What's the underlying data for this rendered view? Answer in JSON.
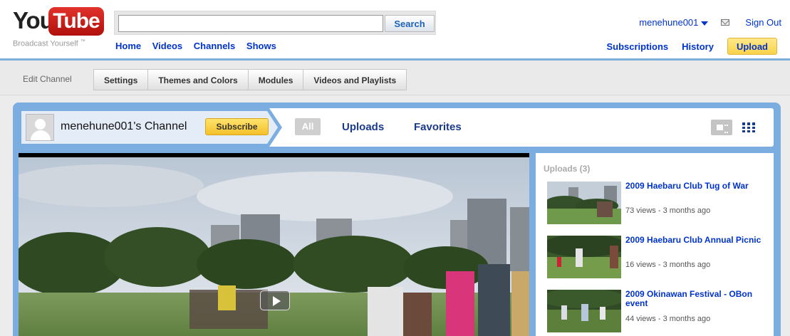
{
  "logo": {
    "you": "You",
    "tube": "Tube",
    "tagline": "Broadcast Yourself",
    "tm": "™"
  },
  "search": {
    "value": "",
    "placeholder": "",
    "button": "Search"
  },
  "main_nav": [
    "Home",
    "Videos",
    "Channels",
    "Shows"
  ],
  "user": {
    "name": "menehune001",
    "sign_out": "Sign Out"
  },
  "sub_nav": {
    "subscriptions": "Subscriptions",
    "history": "History",
    "upload": "Upload"
  },
  "edit_bar": {
    "label": "Edit Channel",
    "tabs": [
      "Settings",
      "Themes and Colors",
      "Modules",
      "Videos and Playlists"
    ]
  },
  "channel": {
    "name": "menehune001's Channel",
    "subscribe": "Subscribe",
    "tabs": {
      "all": "All",
      "uploads": "Uploads",
      "favorites": "Favorites"
    }
  },
  "uploads": {
    "heading": "Uploads (3)",
    "items": [
      {
        "title": "2009 Haebaru Club Tug of War",
        "meta": "73 views - 3 months ago"
      },
      {
        "title": "2009 Haebaru Club Annual Picnic",
        "meta": "16 views - 3 months ago"
      },
      {
        "title": "2009 Okinawan Festival - OBon event",
        "meta": "44 views - 3 months ago"
      }
    ]
  },
  "colors": {
    "accent": "#7cade0",
    "link": "#0033cc",
    "logo_red": "#cc181e",
    "upload_yellow": "#fbd34a"
  }
}
